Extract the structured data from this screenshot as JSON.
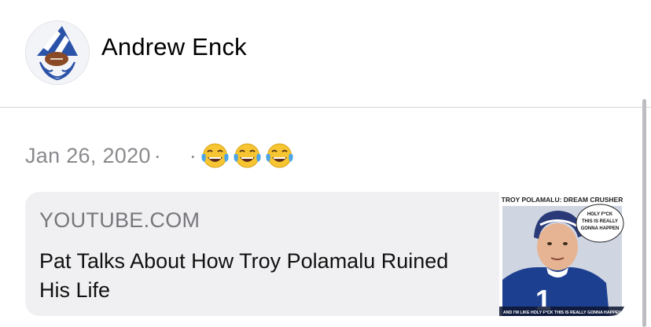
{
  "header": {
    "author_name": "Andrew Enck",
    "avatar_icon": "gnome-avatar-icon"
  },
  "post": {
    "date": "Jan 26, 2020",
    "separator": "·",
    "reactions": [
      "😂",
      "😂",
      "😂"
    ],
    "reaction_icon": "face-with-tears-of-joy-icon"
  },
  "link_preview": {
    "domain": "YOUTUBE.COM",
    "title": "Pat Talks About How Troy Polamalu Ruined His Life",
    "thumbnail": {
      "top_caption": "TROY POLAMALU: DREAM CRUSHER",
      "bubble_text": [
        "HOLY F*CK",
        "THIS IS REALLY",
        "GONNA HAPPEN"
      ],
      "bottom_caption": "AND I'M LIKE HOLY F*CK THIS IS REALLY GONNA HAPPEN"
    }
  },
  "colors": {
    "background": "#ffffff",
    "card_background": "#f0f0f2",
    "secondary_text": "#8a8a8e",
    "divider": "#d6d6da",
    "jersey_blue": "#1d3f8f"
  }
}
